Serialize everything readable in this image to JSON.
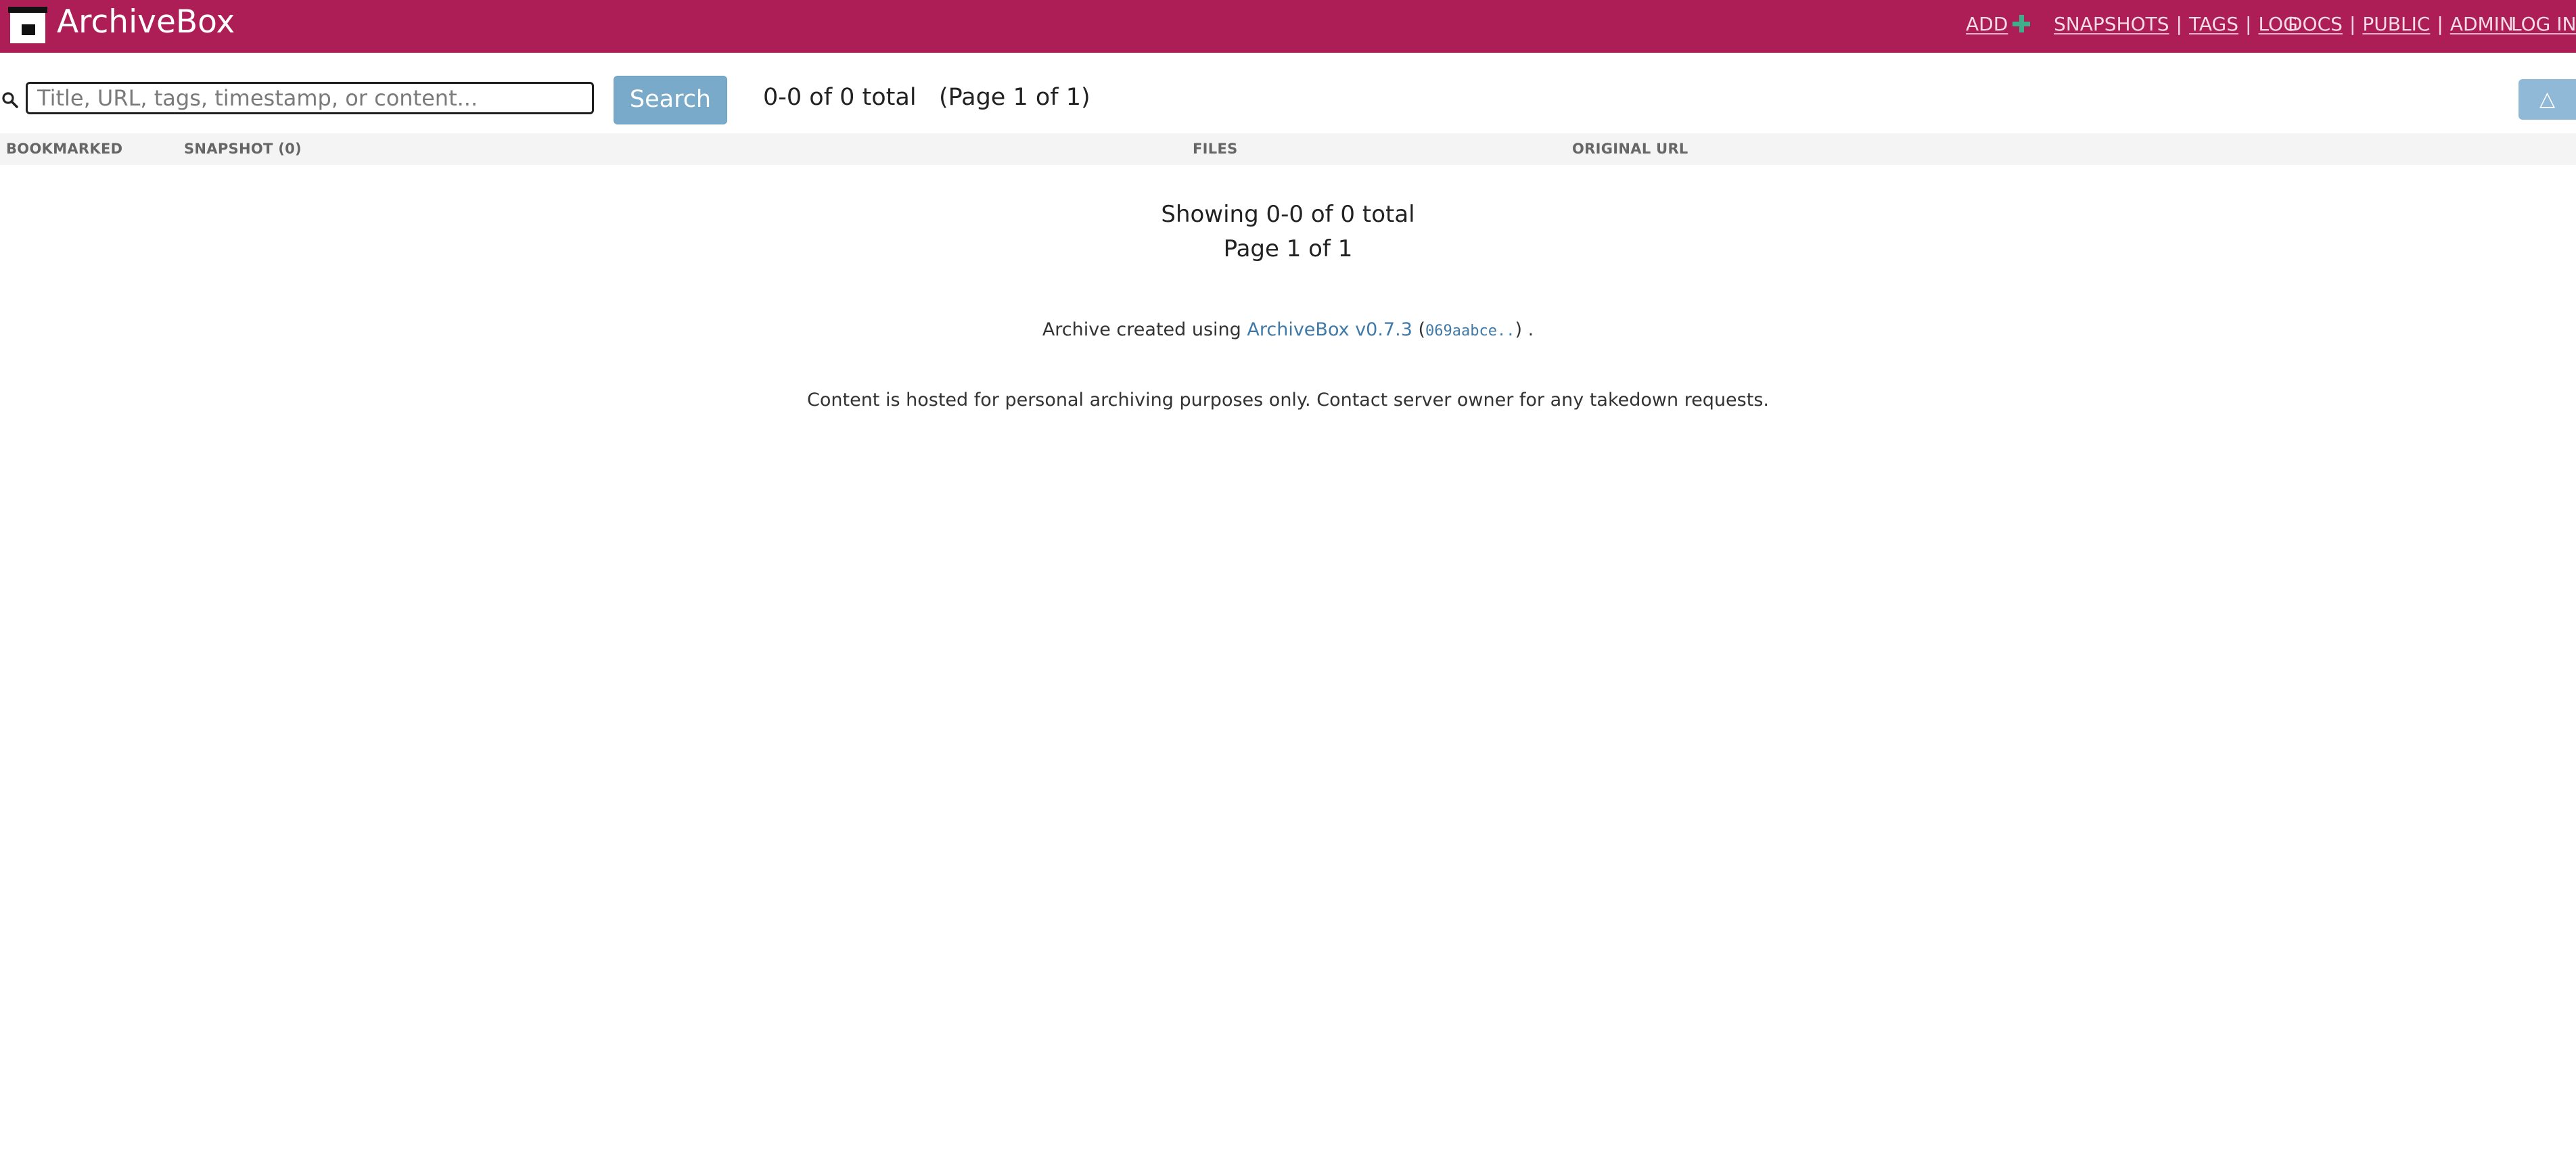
{
  "header": {
    "brand": "ArchiveBox",
    "nav": {
      "add": "ADD",
      "snapshots": "SNAPSHOTS",
      "tags": "TAGS",
      "log": "LOG",
      "docs": "DOCS",
      "public": "PUBLIC",
      "admin": "ADMIN",
      "login": "LOG IN",
      "separator": "|"
    }
  },
  "toolbar": {
    "search_placeholder": "Title, URL, tags, timestamp, or content...",
    "search_value": "",
    "search_button": "Search",
    "result_count": "0-0 of 0 total   (Page 1 of 1)",
    "top_button": "△"
  },
  "table": {
    "columns": [
      "BOOKMARKED",
      "SNAPSHOT (0)",
      "FILES",
      "ORIGINAL URL"
    ]
  },
  "results": {
    "showing": "Showing 0-0 of 0 total",
    "page": "Page 1 of 1"
  },
  "footer": {
    "archive_prefix": "Archive created using",
    "version_link": "ArchiveBox v0.7.3",
    "commit_open": "(",
    "commit_hash": "069aabce..",
    "commit_close": ") .",
    "notice": "Content is hosted for personal archiving purposes only. Contact server owner for any takedown requests."
  },
  "colors": {
    "header_bg": "#ad1d56",
    "accent_link": "#3f79a8",
    "search_button_bg": "#79aac9",
    "plus_icon": "#3fae8a"
  }
}
